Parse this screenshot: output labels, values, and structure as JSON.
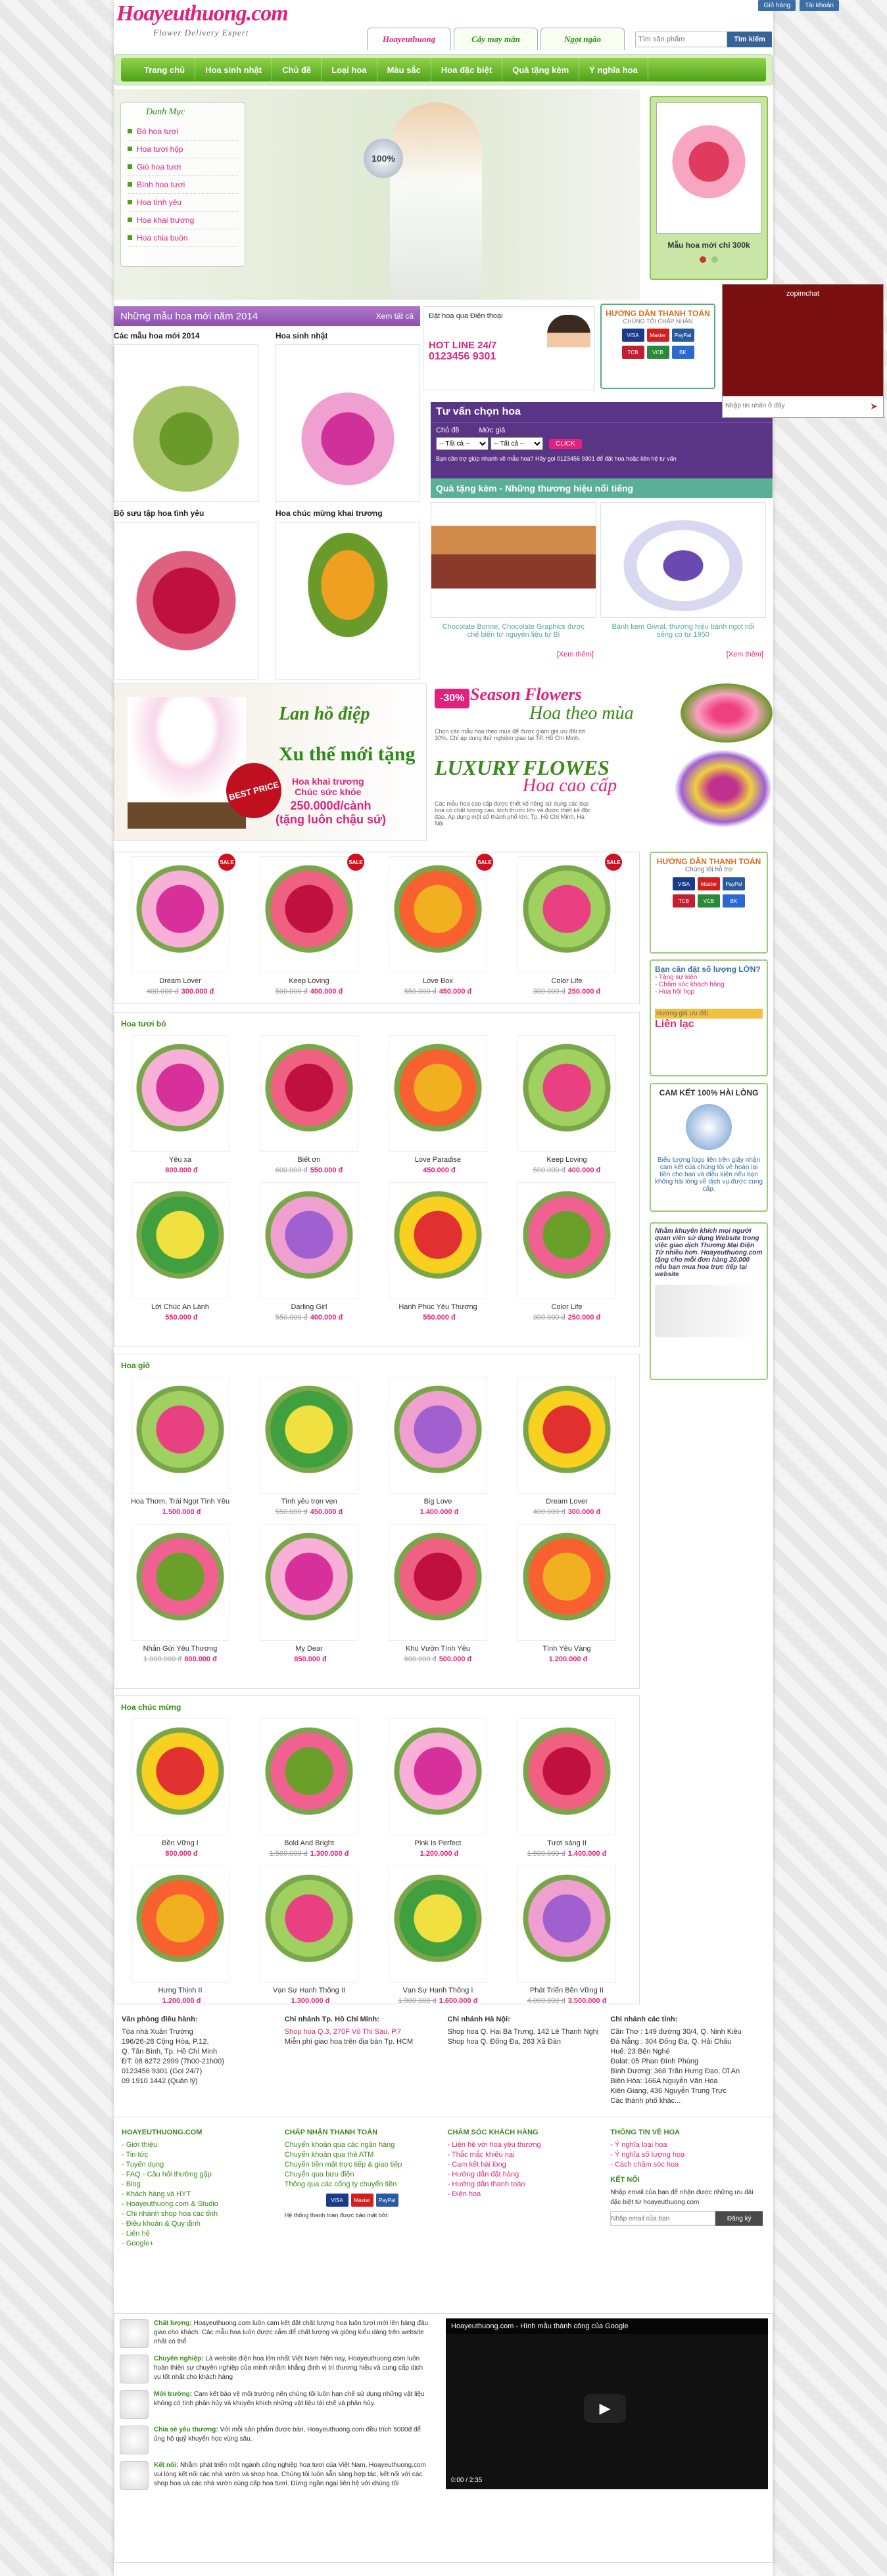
{
  "site": {
    "logo": "Hoayeuthuong.com",
    "slogan": "Flower Delivery Expert",
    "toplinks": [
      "Giỏ hàng",
      "Tài khoản"
    ],
    "tabs": [
      "Hoayeuthuong",
      "Cây may mắn",
      "Ngọt ngào"
    ],
    "search_placeholder": "Tìm sản phẩm",
    "search_button": "Tìm kiếm"
  },
  "nav": [
    "Trang chủ",
    "Hoa sinh nhật",
    "Chủ đề",
    "Loại hoa",
    "Màu sắc",
    "Hoa đặc biệt",
    "Quà tặng kèm",
    "Ý nghĩa hoa"
  ],
  "danhmuc": {
    "title": "Danh Mục",
    "items": [
      "Bó hoa tươi",
      "Hoa tươi hộp",
      "Giỏ hoa tươi",
      "Bình hoa tươi",
      "Hoa tình yêu",
      "Hoa khai trương",
      "Hoa chia buồn"
    ]
  },
  "hero_badge": "100%",
  "promo": {
    "caption": "Mẫu hoa mới chỉ 300k"
  },
  "new2014": {
    "title": "Những mẫu hoa mới năm 2014",
    "more": "Xem tất cả",
    "tiles": [
      "Các mẫu hoa mới 2014",
      "Hoa sinh nhật",
      "Bộ sưu tập hoa tình yêu",
      "Hoa chúc mừng khai trương"
    ]
  },
  "hotline": {
    "l1": "Đặt hoa qua Điện thoại",
    "l2": "HOT LINE 24/7",
    "l3": "0123456 9301"
  },
  "payguide": {
    "title": "HƯỚNG DẪN THANH TOÁN",
    "sub": "CHÚNG TÔI CHẤP NHẬN",
    "cards": [
      "VISA",
      "Master",
      "PayPal",
      "TCB",
      "VCB",
      "BK"
    ]
  },
  "chat": {
    "title": "zopimchat",
    "placeholder": "Nhập tin nhắn ở đây"
  },
  "tuvan": {
    "title": "Tư vấn chọn hoa",
    "l1": "Chủ đề",
    "l2": "Mức giá",
    "opt": "-- Tất cả --",
    "button": "CLICK",
    "note": "Bạn cần trợ giúp nhanh về mẫu hoa? Hãy gọi 0123456 9301 để đặt hoa hoặc liên hệ tư vấn"
  },
  "quatang": {
    "title": "Quà tặng kèm - Những thương hiệu nổi tiếng",
    "items": [
      {
        "cap": "Chocolate Bonne, Chocolate Graphics được chế biến từ nguyên liệu tự Bỉ",
        "more": "[Xem thêm]"
      },
      {
        "cap": "Bánh kem Givral, thương hiệu bánh ngọt nổi tiếng có từ 1950",
        "more": "[Xem thêm]"
      }
    ]
  },
  "banner1": {
    "h1": "Lan hồ điệp",
    "h2": "Xu thế mới tặng",
    "h3": "Hoa khai trương\nChúc sức khỏe",
    "h4": "250.000đ/cành\n(tặng luôn chậu sứ)",
    "best": "BEST PRICE"
  },
  "season": {
    "sale": "-30%",
    "s1": "Season Flowers",
    "s2": "Hoa theo mùa",
    "p1": "Chọn các mẫu hoa theo mùa để được giảm giá ưu đãi tới 30%. Chỉ áp dụng thử nghiệm giao tại TP. Hồ Chí Minh.",
    "l1": "LUXURY FLOWES",
    "l2": "Hoa cao cấp",
    "p2": "Các mẫu hoa cao cấp được thiết kế riêng sử dụng các loại hoa có chất lượng cao, kích thước lớn và được thiết kế độc đáo. Áp dụng một số thành phố lớn: Tp. Hồ Chí Minh, Hà Nội"
  },
  "products_sale": [
    {
      "name": "Dream Lover",
      "old": "400.000 đ",
      "new": "300.000 đ"
    },
    {
      "name": "Keep Loving",
      "old": "500.000 đ",
      "new": "400.000 đ"
    },
    {
      "name": "Love Box",
      "old": "550.000 đ",
      "new": "450.000 đ"
    },
    {
      "name": "Color Life",
      "old": "300.000 đ",
      "new": "250.000 đ"
    }
  ],
  "section_bo": {
    "title": "Hoa tươi bó",
    "items": [
      {
        "name": "Yêu xa",
        "old": "",
        "new": "800.000 đ"
      },
      {
        "name": "Biết ơn",
        "old": "600.000 đ",
        "new": "550.000 đ"
      },
      {
        "name": "Love Paradise",
        "old": "",
        "new": "450.000 đ"
      },
      {
        "name": "Keep Loving",
        "old": "500.000 đ",
        "new": "400.000 đ"
      },
      {
        "name": "Lời Chúc An Lành",
        "old": "",
        "new": "550.000 đ"
      },
      {
        "name": "Darling Girl",
        "old": "550.000 đ",
        "new": "400.000 đ"
      },
      {
        "name": "Hạnh Phúc Yêu Thương",
        "old": "",
        "new": "550.000 đ"
      },
      {
        "name": "Color Life",
        "old": "300.000 đ",
        "new": "250.000 đ"
      }
    ]
  },
  "section_gio": {
    "title": "Hoa giỏ",
    "items": [
      {
        "name": "Hoa Thơm, Trái Ngọt Tình Yêu",
        "old": "",
        "new": "1.500.000 đ"
      },
      {
        "name": "Tình yêu trọn vẹn",
        "old": "550.000 đ",
        "new": "450.000 đ"
      },
      {
        "name": "Big Love",
        "old": "",
        "new": "1.400.000 đ"
      },
      {
        "name": "Dream Lover",
        "old": "400.000 đ",
        "new": "300.000 đ"
      },
      {
        "name": "Nhắn Gửi Yêu Thương",
        "old": "1.000.000 đ",
        "new": "800.000 đ"
      },
      {
        "name": "My Dear",
        "old": "",
        "new": "850.000 đ"
      },
      {
        "name": "Khu Vườn Tình Yêu",
        "old": "600.000 đ",
        "new": "500.000 đ"
      },
      {
        "name": "Tình Yêu Vàng",
        "old": "",
        "new": "1.200.000 đ"
      }
    ]
  },
  "section_cm": {
    "title": "Hoa chúc mừng",
    "items": [
      {
        "name": "Bền Vững I",
        "old": "",
        "new": "800.000 đ"
      },
      {
        "name": "Bold And Bright",
        "old": "1.500.000 đ",
        "new": "1.300.000 đ"
      },
      {
        "name": "Pink Is Perfect",
        "old": "",
        "new": "1.200.000 đ"
      },
      {
        "name": "Tươi sáng II",
        "old": "1.600.000 đ",
        "new": "1.400.000 đ"
      },
      {
        "name": "Hưng Thịnh II",
        "old": "",
        "new": "1.200.000 đ"
      },
      {
        "name": "Vạn Sự Hanh Thông II",
        "old": "",
        "new": "1.300.000 đ"
      },
      {
        "name": "Vạn Sự Hanh Thông I",
        "old": "1.900.000 đ",
        "new": "1.600.000 đ"
      },
      {
        "name": "Phát Triển Bền Vững II",
        "old": "4.000.000 đ",
        "new": "3.500.000 đ"
      }
    ]
  },
  "side": {
    "b1": {
      "title": "HƯỚNG DẪN THANH TOÁN",
      "sub": "Chúng tôi hỗ trợ"
    },
    "b2": {
      "title": "Bạn cần đặt số lượng LỚN?",
      "items": [
        "- Tặng sự kiện",
        "- Chăm sóc khách hàng",
        "- Hoa hội họp"
      ],
      "guide": "Hướng giá ưu đãi",
      "contact": "Liên lạc"
    },
    "b3": {
      "title": "CAM KẾT 100% HÀI LÒNG",
      "text": "Biểu tượng logo liên trên giấy nhận cam kết của chúng tôi về hoàn lại tiền cho bạn và điều kiện nếu bạn không hài lòng về dịch vụ được cung cấp."
    },
    "b4": {
      "text": "Nhằm khuyến khích mọi người quan viên sử dụng Website trong việc giao dịch Thương Mại Điện Tử nhiều hơn. Hoayeuthuong.com tặng cho mỗi đơn hàng 20.000 nếu bạn mua hoa trực tiếp tại website"
    }
  },
  "footer": {
    "offices": [
      {
        "title": "Văn phòng điều hành:",
        "lines": [
          "Tòa nhà Xuân Trường",
          "196/26-28 Cộng Hòa, P.12,",
          "Q. Tân Bình, Tp. Hồ Chí Minh",
          "ĐT: 08 6272 2999 (7h00-21h00)",
          "0123456 9301 (Gọi 24/7)",
          "09 1910 1442 (Quản lý)"
        ]
      },
      {
        "title": "Chi nhánh Tp. Hồ Chí Minh:",
        "lines": [
          "Shop hoa Q.3, 270F Võ Thị Sáu, P.7",
          "Miễn phí giao hoa trên địa bàn Tp. HCM"
        ]
      },
      {
        "title": "Chi nhánh Hà Nội:",
        "lines": [
          "Shop hoa Q. Hai Bà Trưng, 142 Lê Thanh Nghị",
          "Shop hoa Q. Đống Đa, 263 Xã Đàn"
        ]
      },
      {
        "title": "Chi nhánh các tỉnh:",
        "lines": [
          "Cần Thơ : 149 đường 30/4, Q. Ninh Kiều",
          "Đà Nẵng : 304 Đống Đa, Q. Hải Châu",
          "Huế: 23 Bến Nghé",
          "Đalat: 05 Phan Đình Phùng",
          "Bình Dương: 368 Trần Hưng Đạo, Dĩ An",
          "Biên Hòa: 166A Nguyễn Văn Hoa",
          "Kiên Giang, 436 Nguyễn Trung Trực",
          "Các thành phố khác..."
        ]
      }
    ],
    "cols": [
      {
        "title": "HOAYEUTHUONG.COM",
        "items": [
          "- Giới thiệu",
          "- Tin tức",
          "- Tuyển dụng",
          "- FAQ - Câu hỏi thường gặp",
          "- Blog",
          "- Khách hàng và HYT",
          "- Hoayeuthuong.com & Studio",
          "- Chi nhánh shop hoa các tỉnh",
          "- Điều khoản & Quy định",
          "- Liên hệ",
          "- Google+"
        ]
      },
      {
        "title": "CHẤP NHẬN THANH TOÁN",
        "items": [
          "Chuyển khoản qua các ngân hàng",
          "Chuyển khoản qua thẻ ATM",
          "Chuyển tiền mặt trực tiếp & giao tiếp",
          "Chuyển qua bưu điện",
          "Thông qua các cổng ty chuyển tiền"
        ],
        "note": "Hệ thống thanh toán được bảo mật bởi:"
      },
      {
        "title": "CHĂM SÓC KHÁCH HÀNG",
        "items": [
          "- Liên hệ với hoa yêu thương",
          "- Thắc mắc khiếu nại",
          "- Cam kết hài lòng",
          "- Hướng dẫn đặt hàng",
          "- Hướng dẫn thanh toán",
          "- Điện hoa"
        ]
      },
      {
        "title": "THÔNG TIN VỀ HOA",
        "items": [
          "- Ý nghĩa loại hoa",
          "- Ý nghĩa số lượng hoa",
          "- Cách chăm sóc hoa"
        ],
        "title2": "KẾT NỐI",
        "text": "Nhập email của bạn để nhận được những ưu đãi đặc biệt từ hoayeuthuong.com",
        "placeholder": "Nhập email của bạn",
        "button": "Đăng ký"
      }
    ]
  },
  "about": [
    {
      "b": "Chất lượng:",
      "t": "Hoayeuthuong.com luôn cam kết đặt chất lượng hoa luôn tươi mới lên hàng đầu giao cho khách. Các mẫu hoa luôn được cắm để chất lượng và giống kiểu dáng trên website nhất có thể"
    },
    {
      "b": "Chuyên nghiệp:",
      "t": "Là website điện hoa lớn nhất Việt Nam hiện nay, Hoayeuthuong.com luôn hoàn thiện sự chuyên nghiệp của mình nhằm khẳng định vị trí thương hiệu và cung cấp dịch vụ tốt nhất cho khách hàng"
    },
    {
      "b": "Mới trường:",
      "t": "Cam kết bảo vệ môi trường nên chúng tôi luôn hạn chế sử dụng những vật liệu không có tính phân hủy và khuyến khích những vật liệu tái chế và phân hủy."
    },
    {
      "b": "Chia sẻ yêu thương:",
      "t": "Với mỗi sản phẩm được bán, Hoayeuthuong.com đều trích 5000đ để ủng hộ quỹ khuyến học vùng sâu."
    },
    {
      "b": "Kết nối:",
      "t": "Nhằm phát triển một ngành công nghiệp hoa tươi của Việt Nam, Hoayeuthuong.com vui lòng kết nối các nhà vườn và shop hoa. Chúng tôi luôn sẵn sàng hợp tác, kết nối với các shop hoa và các nhà vườn cùng cấp hoa tươi. Đừng ngần ngại liên hệ với chúng tôi"
    }
  ],
  "video": {
    "title": "Hoayeuthuong.com - Hình mẫu thành công của Google",
    "time": "0:00 / 2:35"
  }
}
